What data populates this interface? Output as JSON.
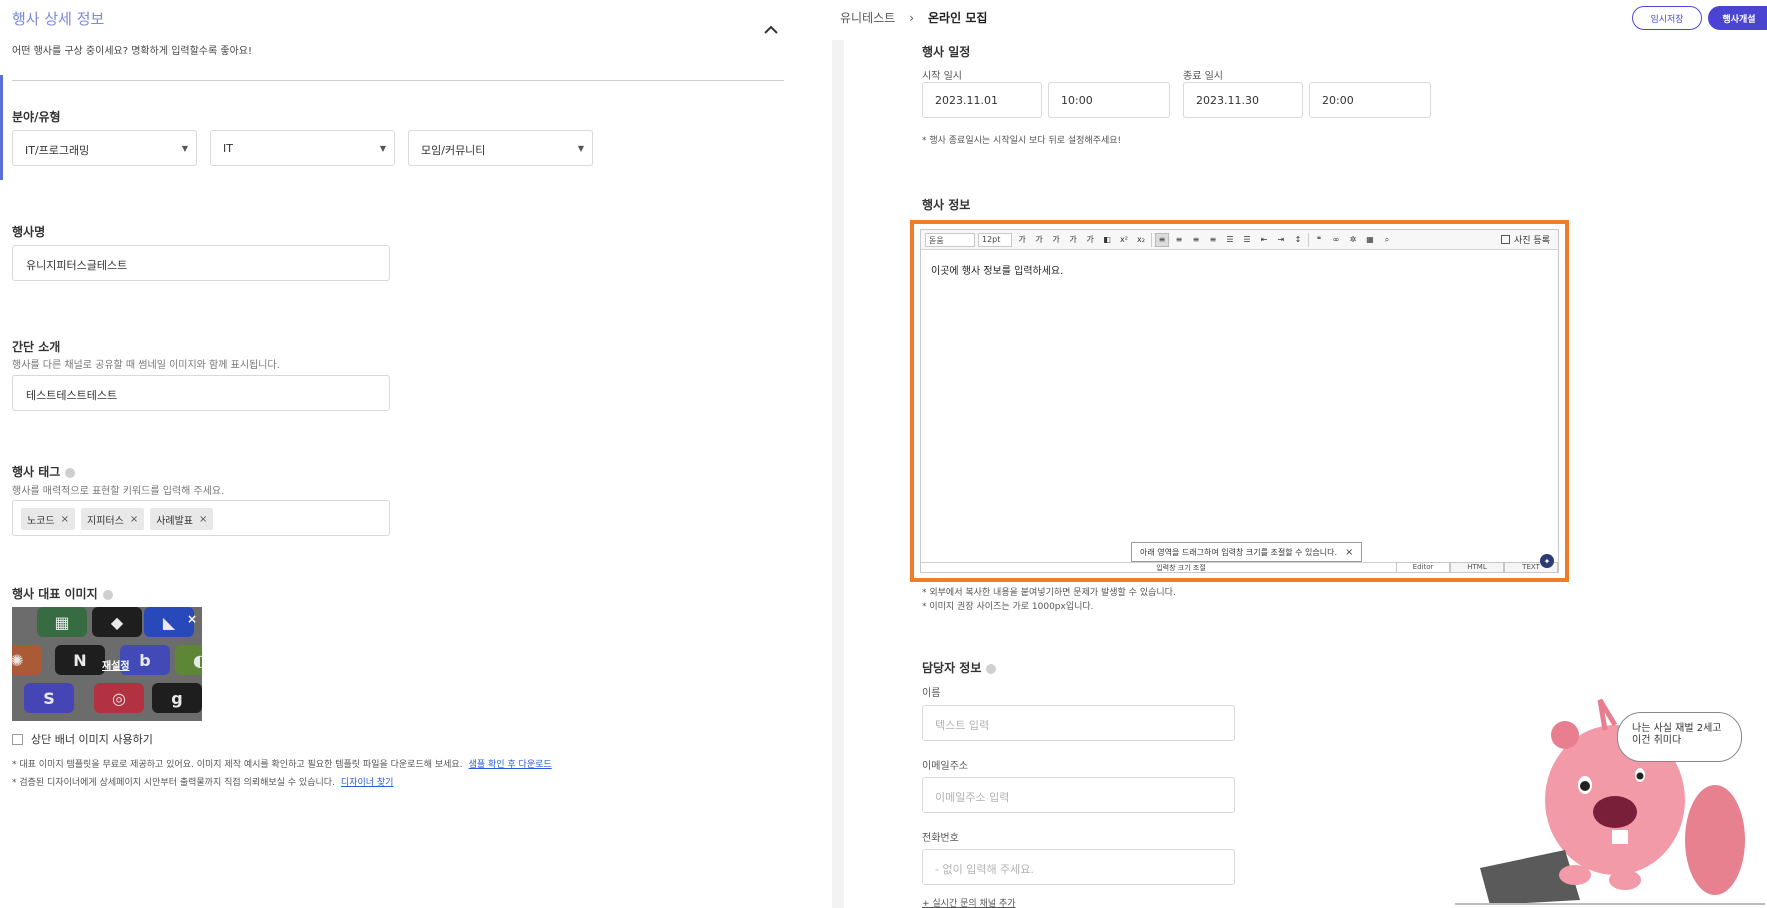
{
  "left": {
    "section_title": "행사 상세 정보",
    "section_sub": "어떤 행사를 구상 중이세요? 명확하게 입력할수록 좋아요!",
    "category": {
      "label": "분야/유형",
      "select1": "IT/프로그래밍",
      "select2": "IT",
      "select3": "모임/커뮤니티"
    },
    "event_name": {
      "label": "행사명",
      "value": "유니지피터스글테스트"
    },
    "summary": {
      "label": "간단 소개",
      "hint": "행사를 다른 채널로 공유할 때 썸네일 이미지와 함께 표시됩니다.",
      "value": "테스트테스트테스트"
    },
    "tags": {
      "label": "행사 태그",
      "hint": "행사를 매력적으로 표현할 키워드를 입력해 주세요.",
      "items": [
        "노코드",
        "지피터스",
        "사례발표"
      ],
      "remove_glyph": "×"
    },
    "image": {
      "label": "행사 대표 이미지",
      "reset_label": "재설정",
      "close_glyph": "×"
    },
    "banner_checkbox_label": "상단 배너 이미지 사용하기",
    "note1": "* 대표 이미지 템플릿을 무료로 제공하고 있어요. 이미지 제작 예시를 확인하고 필요한 템플릿 파일을 다운로드해 보세요.",
    "note1_link": "샘플 확인 후 다운로드",
    "note2": "* 검증된 디자이너에게 상세페이지 시안부터 출력물까지 직접 의뢰해보실 수 있습니다.",
    "note2_link": "디자이너 찾기"
  },
  "right": {
    "breadcrumb": [
      "유니테스트",
      "온라인 모집"
    ],
    "breadcrumb_sep": "›",
    "btn_draft": "임시저장",
    "btn_open": "행사개설",
    "schedule": {
      "label": "행사 일정",
      "start_label": "시작 일시",
      "end_label": "종료 일시",
      "start_date": "2023.11.01",
      "start_time": "10:00",
      "end_date": "2023.11.30",
      "end_time": "20:00",
      "note": "* 행사 종료일시는 시작일시 보다 뒤로 설정해주세요!"
    },
    "info": {
      "label": "행사 정보",
      "toolbar": {
        "font": "돋움",
        "size": "12pt",
        "photo_label": "사진 등록"
      },
      "body_text": "이곳에 행사 정보를 입력하세요.",
      "tip_text": "아래 영역을 드래그하여 입력창 크기를 조절할 수 있습니다.",
      "tip_close": "×",
      "resize_label": "입력창 크기 조절",
      "modes": [
        "Editor",
        "HTML",
        "TEXT"
      ],
      "note1": "* 외부에서 복사한 내용을 붙여넣기하면 문제가 발생할 수 있습니다.",
      "note2": "* 이미지 권장 사이즈는 가로 1000px입니다."
    },
    "contact": {
      "label": "담당자 정보",
      "name_label": "이름",
      "name_placeholder": "텍스트 입력",
      "email_label": "이메일주소",
      "email_placeholder": "이메일주소 입력",
      "phone_label": "전화번호",
      "phone_placeholder": "- 없이 입력해 주세요.",
      "add_link": "+ 실시간 문의 채널 추가"
    }
  },
  "sticker": {
    "bubble_text": "나는 사실 재벌 2세고 이건 취미다"
  },
  "colors": {
    "accent": "#4a44d1",
    "highlight": "#f07c28",
    "title_blue": "#7b8bd8"
  }
}
